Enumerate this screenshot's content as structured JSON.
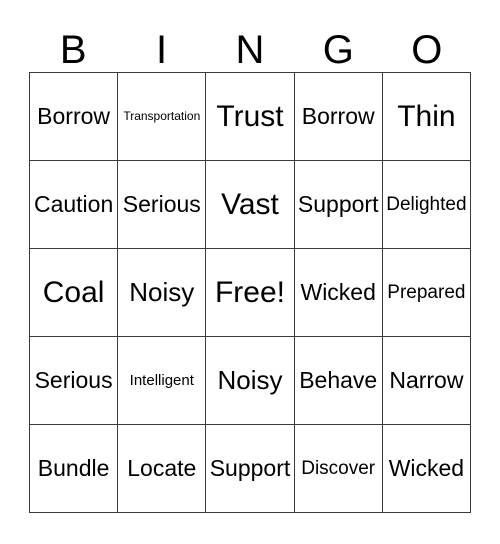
{
  "card": {
    "title": "BINGO",
    "header_letters": [
      "B",
      "I",
      "N",
      "G",
      "O"
    ],
    "free_space_label": "Free!",
    "colors": {
      "border": "#3a3a3a",
      "text": "#000000",
      "background": "#ffffff"
    },
    "grid": {
      "columns": 5,
      "rows": 5,
      "cells": [
        [
          {
            "label": "Borrow",
            "size": "lg"
          },
          {
            "label": "Transportation",
            "size": "xs"
          },
          {
            "label": "Trust",
            "size": "xxl"
          },
          {
            "label": "Borrow",
            "size": "lg"
          },
          {
            "label": "Thin",
            "size": "xxl"
          }
        ],
        [
          {
            "label": "Caution",
            "size": "lg"
          },
          {
            "label": "Serious",
            "size": "lg"
          },
          {
            "label": "Vast",
            "size": "xxl"
          },
          {
            "label": "Support",
            "size": "lg"
          },
          {
            "label": "Delighted",
            "size": "md"
          }
        ],
        [
          {
            "label": "Coal",
            "size": "xxl"
          },
          {
            "label": "Noisy",
            "size": "xl"
          },
          {
            "label": "Free!",
            "size": "xxl"
          },
          {
            "label": "Wicked",
            "size": "lg"
          },
          {
            "label": "Prepared",
            "size": "md"
          }
        ],
        [
          {
            "label": "Serious",
            "size": "lg"
          },
          {
            "label": "Intelligent",
            "size": "sm"
          },
          {
            "label": "Noisy",
            "size": "xl"
          },
          {
            "label": "Behave",
            "size": "lg"
          },
          {
            "label": "Narrow",
            "size": "lg"
          }
        ],
        [
          {
            "label": "Bundle",
            "size": "lg"
          },
          {
            "label": "Locate",
            "size": "lg"
          },
          {
            "label": "Support",
            "size": "lg"
          },
          {
            "label": "Discover",
            "size": "md"
          },
          {
            "label": "Wicked",
            "size": "lg"
          }
        ]
      ]
    }
  }
}
